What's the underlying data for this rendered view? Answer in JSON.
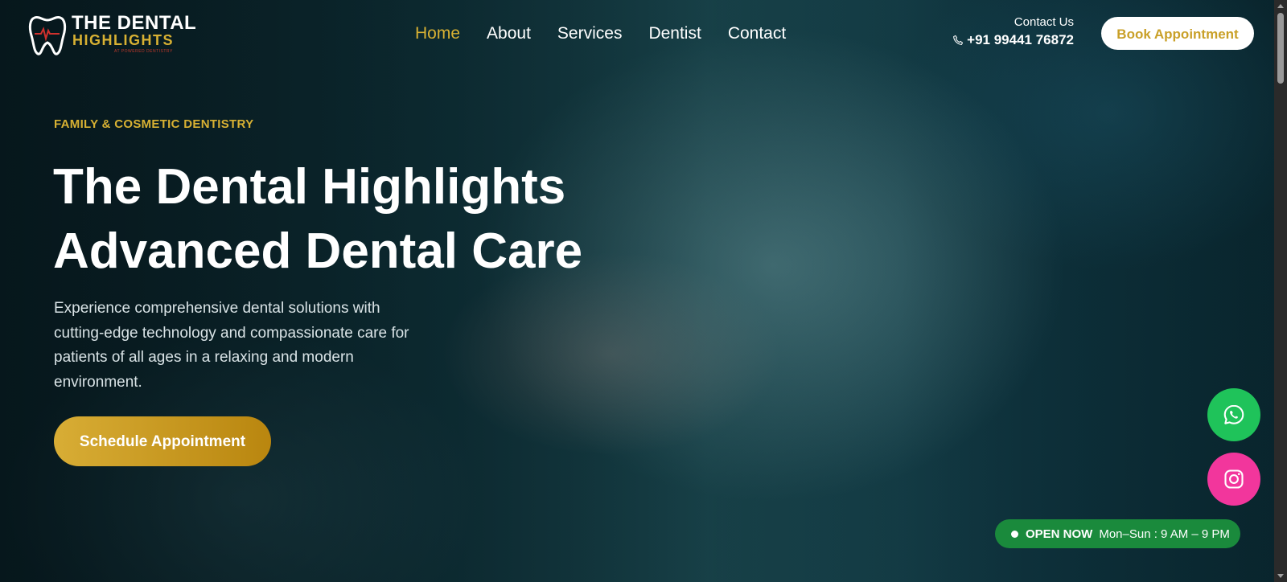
{
  "brand": {
    "line1": "THE DENTAL",
    "line2": "HIGHLIGHTS",
    "line3": "AT POWERED DENTISTRY"
  },
  "nav": {
    "items": [
      {
        "label": "Home",
        "active": true
      },
      {
        "label": "About",
        "active": false
      },
      {
        "label": "Services",
        "active": false
      },
      {
        "label": "Dentist",
        "active": false
      },
      {
        "label": "Contact",
        "active": false
      }
    ]
  },
  "contact": {
    "label": "Contact Us",
    "phone": "+91 99441 76872"
  },
  "header": {
    "book_label": "Book Appointment"
  },
  "hero": {
    "eyebrow": "FAMILY & COSMETIC DENTISTRY",
    "title_line1": "The Dental Highlights",
    "title_line2": "Advanced Dental Care",
    "description": "Experience comprehensive dental solutions with cutting-edge technology and compassionate care for patients of all ages in a relaxing and modern environment.",
    "cta_label": "Schedule Appointment"
  },
  "status": {
    "label": "OPEN NOW",
    "hours": "Mon–Sun : 9 AM – 9 PM"
  },
  "colors": {
    "accent_gold": "#d8b133",
    "whatsapp_green": "#1fc35a",
    "instagram_pink": "#f2369c",
    "open_badge_green": "#1a8a3c"
  },
  "icons": {
    "logo": "tooth-icon",
    "phone": "phone-icon",
    "whatsapp": "whatsapp-icon",
    "instagram": "instagram-icon"
  }
}
